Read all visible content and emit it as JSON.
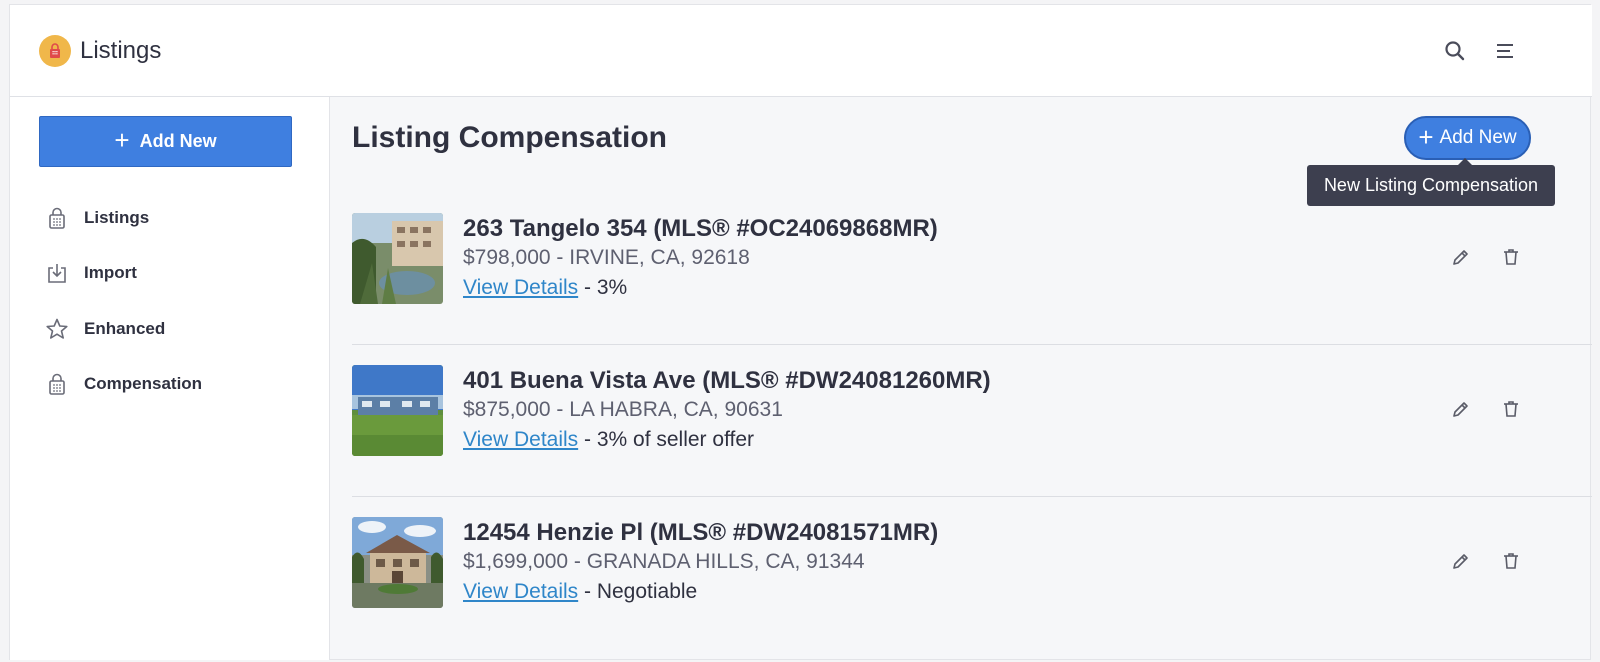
{
  "header": {
    "app_title": "Listings",
    "logo_icon": "lock-icon",
    "search_icon": "search-icon",
    "menu_icon": "menu-icon"
  },
  "sidebar": {
    "add_button_label": "Add New",
    "items": [
      {
        "label": "Listings",
        "icon": "lock-icon"
      },
      {
        "label": "Import",
        "icon": "import-icon"
      },
      {
        "label": "Enhanced",
        "icon": "star-icon"
      },
      {
        "label": "Compensation",
        "icon": "lock-icon"
      }
    ]
  },
  "main": {
    "title": "Listing Compensation",
    "add_button_label": "Add New",
    "tooltip": "New Listing Compensation",
    "rows": [
      {
        "title": "263 Tangelo 354 (MLS® #OC24069868MR)",
        "price_location": "$798,000 - IRVINE, CA, 92618",
        "link": "View Details",
        "compensation": " - 3%"
      },
      {
        "title": "401 Buena Vista Ave (MLS® #DW24081260MR)",
        "price_location": "$875,000 - LA HABRA, CA, 90631",
        "link": "View Details",
        "compensation": " - 3% of seller offer"
      },
      {
        "title": "12454 Henzie Pl (MLS® #DW24081571MR)",
        "price_location": "$1,699,000 - GRANADA HILLS, CA, 91344",
        "link": "View Details",
        "compensation": " - Negotiable"
      }
    ]
  },
  "colors": {
    "accent": "#3f7fe0",
    "link": "#2f86c9",
    "tooltip_bg": "#3d3f4f",
    "logo": "#f0b74a"
  }
}
